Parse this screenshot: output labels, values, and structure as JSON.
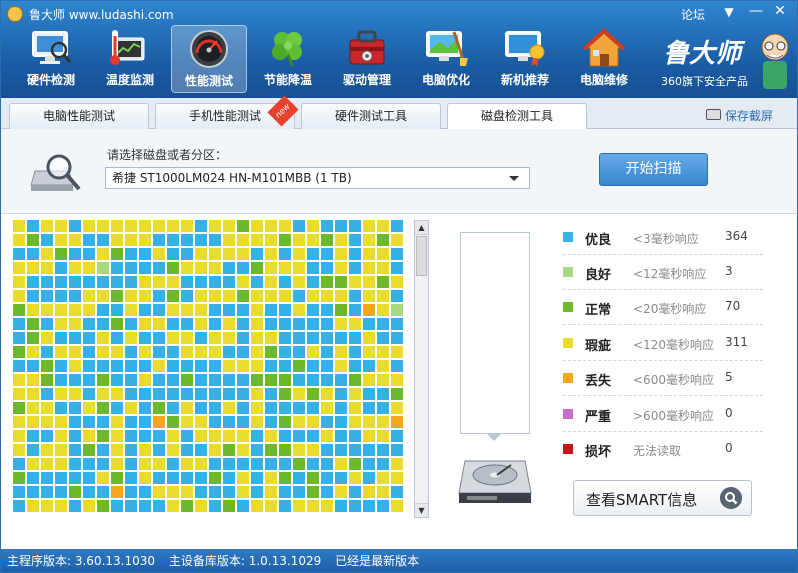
{
  "window": {
    "title": "鲁大师 www.ludashi.com",
    "forum_label": "论坛",
    "menu_icon": "dropdown-menu-icon",
    "minimize_icon": "minimize-icon",
    "close_icon": "close-icon"
  },
  "nav": [
    {
      "label": "硬件检测",
      "icon": "hardware-monitor-icon",
      "active": false
    },
    {
      "label": "温度监测",
      "icon": "thermometer-icon",
      "active": false
    },
    {
      "label": "性能测试",
      "icon": "speedometer-icon",
      "active": true
    },
    {
      "label": "节能降温",
      "icon": "clover-icon",
      "active": false
    },
    {
      "label": "驱动管理",
      "icon": "toolbox-icon",
      "active": false
    },
    {
      "label": "电脑优化",
      "icon": "broom-monitor-icon",
      "active": false
    },
    {
      "label": "新机推荐",
      "icon": "award-monitor-icon",
      "active": false
    },
    {
      "label": "电脑维修",
      "icon": "house-icon",
      "active": false
    }
  ],
  "brand": {
    "name": "鲁大师",
    "subtitle": "360旗下安全产品"
  },
  "tabs": [
    {
      "label": "电脑性能测试",
      "active": false
    },
    {
      "label": "手机性能测试",
      "active": false,
      "badge": "new"
    },
    {
      "label": "硬件测试工具",
      "active": false
    },
    {
      "label": "磁盘检测工具",
      "active": true
    }
  ],
  "save_screenshot_label": "保存截屏",
  "disk_selection": {
    "label": "请选择磁盘或者分区：",
    "selected": "希捷 ST1000LM024 HN-M101MBB  (1 TB)"
  },
  "scan_button_label": "开始扫描",
  "legend": [
    {
      "name": "优良",
      "desc": "<3毫秒响应",
      "count": "364",
      "color": "#35b1e8"
    },
    {
      "name": "良好",
      "desc": "<12毫秒响应",
      "count": "3",
      "color": "#a7d97f"
    },
    {
      "name": "正常",
      "desc": "<20毫秒响应",
      "count": "70",
      "color": "#6eb92b"
    },
    {
      "name": "瑕疵",
      "desc": "<120毫秒响应",
      "count": "311",
      "color": "#e9dc2c"
    },
    {
      "name": "丢失",
      "desc": "<600毫秒响应",
      "count": "5",
      "color": "#f3a71f"
    },
    {
      "name": "严重",
      "desc": ">600毫秒响应",
      "count": "0",
      "color": "#c36fc9"
    },
    {
      "name": "损坏",
      "desc": "无法读取",
      "count": "0",
      "color": "#c8171c"
    }
  ],
  "smart_button_label": "查看SMART信息",
  "status_bar": {
    "main_version": "主程序版本: 3.60.13.1030",
    "db_version": "主设备库版本: 1.0.13.1029",
    "update_status": "已经是最新版本"
  },
  "grid": {
    "columns": 28,
    "rows": 21,
    "block_counts": {
      "excellent": 364,
      "good": 3,
      "normal": 70,
      "flawed": 311,
      "lost": 5,
      "severe": 0,
      "damaged": 0
    },
    "colors": {
      "excellent": "#35b1e8",
      "good": "#a7d97f",
      "normal": "#6eb92b",
      "flawed": "#e9dc2c",
      "lost": "#f3a71f",
      "empty": "#ffffff"
    }
  }
}
